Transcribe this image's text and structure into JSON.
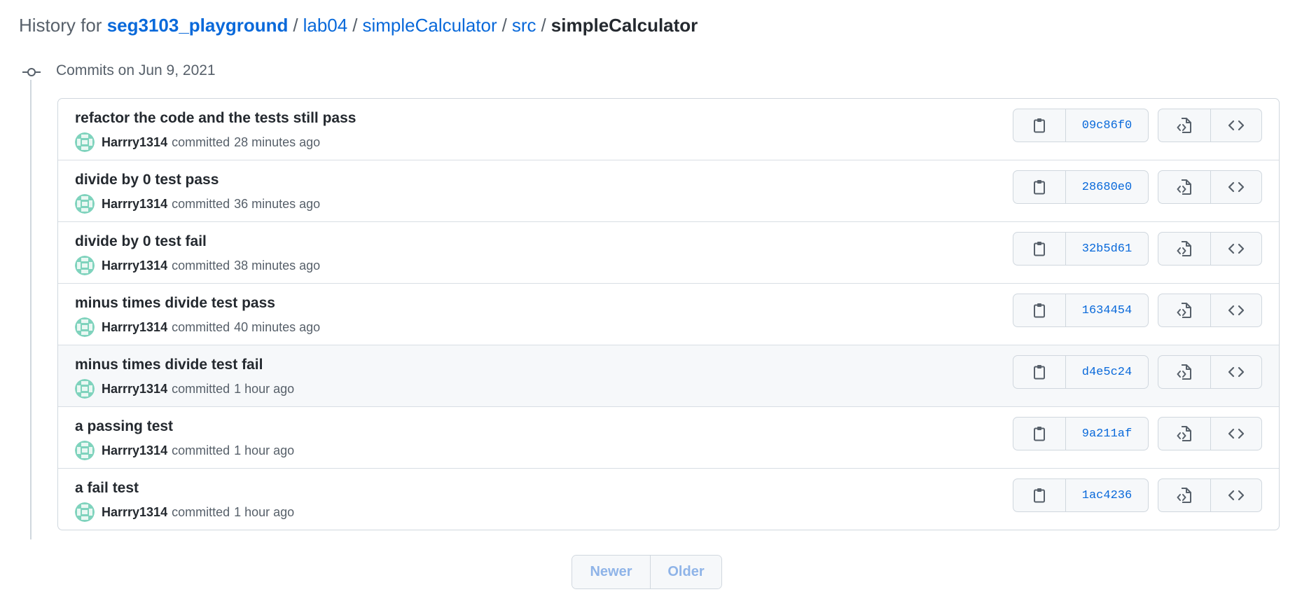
{
  "header": {
    "prefix": "History for",
    "separator": "/",
    "breadcrumbs": [
      "seg3103_playground",
      "lab04",
      "simpleCalculator",
      "src"
    ],
    "current": "simpleCalculator"
  },
  "group": {
    "title": "Commits on Jun 9, 2021"
  },
  "commit_word": "committed",
  "commits": [
    {
      "message": "refactor the code and the tests still pass",
      "author": "Harrry1314",
      "time": "28 minutes ago",
      "sha": "09c86f0"
    },
    {
      "message": "divide by 0 test pass",
      "author": "Harrry1314",
      "time": "36 minutes ago",
      "sha": "28680e0"
    },
    {
      "message": "divide by 0 test fail",
      "author": "Harrry1314",
      "time": "38 minutes ago",
      "sha": "32b5d61"
    },
    {
      "message": "minus times divide test pass",
      "author": "Harrry1314",
      "time": "40 minutes ago",
      "sha": "1634454"
    },
    {
      "message": "minus times divide test fail",
      "author": "Harrry1314",
      "time": "1 hour ago",
      "sha": "d4e5c24"
    },
    {
      "message": "a passing test",
      "author": "Harrry1314",
      "time": "1 hour ago",
      "sha": "9a211af"
    },
    {
      "message": "a fail test",
      "author": "Harrry1314",
      "time": "1 hour ago",
      "sha": "1ac4236"
    }
  ],
  "hovered_row": 4,
  "pagination": {
    "newer": "Newer",
    "older": "Older"
  },
  "icons": {
    "copy": "clipboard-icon",
    "browse_file": "file-code-icon",
    "browse_repo": "code-icon",
    "timeline": "git-commit-icon"
  },
  "colors": {
    "link": "#0969da",
    "avatar": "#7fd3bd",
    "disabled_link": "#8fb4e8"
  }
}
